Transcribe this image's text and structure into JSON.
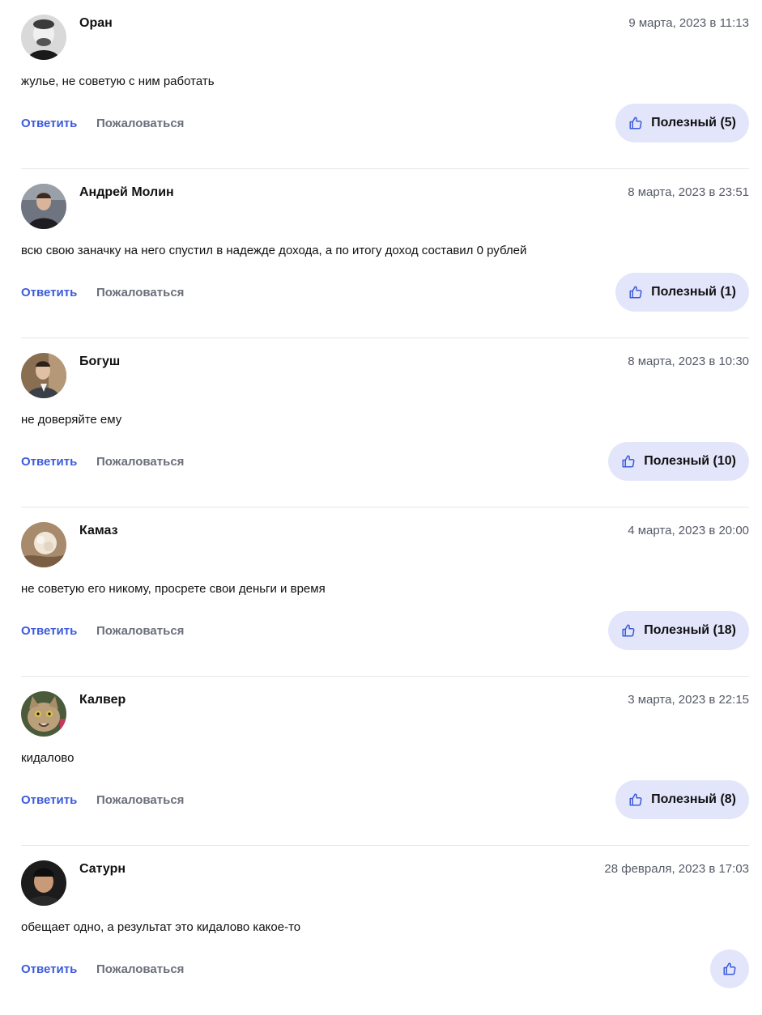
{
  "comments": [
    {
      "author": "Оран",
      "date": "9 марта, 2023 в 11:13",
      "text": "жулье, не советую с ним работать",
      "reply_label": "Ответить",
      "report_label": "Пожаловаться",
      "useful_label": "Полезный (5)"
    },
    {
      "author": "Андрей Молин",
      "date": "8 марта, 2023 в 23:51",
      "text": "всю свою заначку на него спустил в надежде дохода, а по итогу доход составил 0 рублей",
      "reply_label": "Ответить",
      "report_label": "Пожаловаться",
      "useful_label": "Полезный (1)"
    },
    {
      "author": "Богуш",
      "date": "8 марта, 2023 в 10:30",
      "text": "не доверяйте ему",
      "reply_label": "Ответить",
      "report_label": "Пожаловаться",
      "useful_label": "Полезный (10)"
    },
    {
      "author": "Камаз",
      "date": "4 марта, 2023 в 20:00",
      "text": "не советую его никому, просрете свои деньги и время",
      "reply_label": "Ответить",
      "report_label": "Пожаловаться",
      "useful_label": "Полезный (18)"
    },
    {
      "author": "Калвер",
      "date": "3 марта, 2023 в 22:15",
      "text": "кидалово",
      "reply_label": "Ответить",
      "report_label": "Пожаловаться",
      "useful_label": "Полезный (8)"
    },
    {
      "author": "Сатурн",
      "date": "28 февраля, 2023 в 17:03",
      "text": "обещает одно, а результат это кидалово какое-то",
      "reply_label": "Ответить",
      "report_label": "Пожаловаться",
      "useful_label": ""
    }
  ],
  "icons": {
    "useful": "thumbs-up-icon"
  },
  "colors": {
    "reply_link": "#3b5bdb",
    "report_link": "#6b6f7a",
    "useful_button_bg": "#e3e6fb",
    "date_text": "#555a66",
    "divider": "#e6e6ec"
  }
}
